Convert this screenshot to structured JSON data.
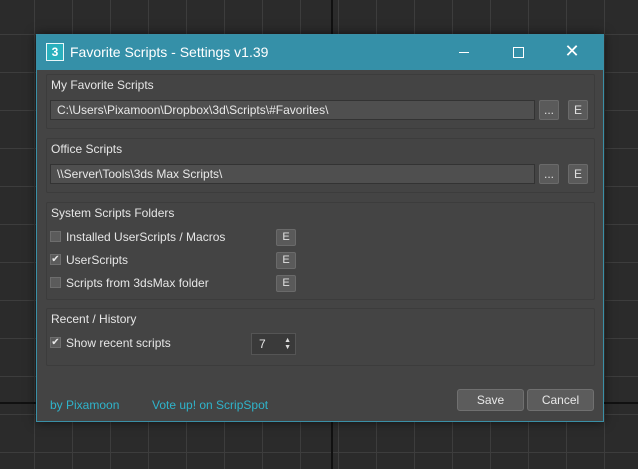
{
  "window": {
    "title": "Favorite Scripts - Settings v1.39",
    "app_icon_glyph": "3",
    "accent_color": "#3590a8",
    "close_glyph": "✕"
  },
  "favorite": {
    "title": "My Favorite Scripts",
    "path": "C:\\Users\\Pixamoon\\Dropbox\\3d\\Scripts\\#Favorites\\",
    "browse_label": "...",
    "edit_label": "E"
  },
  "office": {
    "title": "Office Scripts",
    "path": "\\\\Server\\Tools\\3ds Max Scripts\\",
    "browse_label": "...",
    "edit_label": "E"
  },
  "system": {
    "title": "System Scripts Folders",
    "items": [
      {
        "label": "Installed UserScripts / Macros",
        "checked": false,
        "edit_label": "E"
      },
      {
        "label": "UserScripts",
        "checked": true,
        "edit_label": "E"
      },
      {
        "label": "Scripts from 3dsMax folder",
        "checked": false,
        "edit_label": "E"
      }
    ]
  },
  "recent": {
    "title": "Recent / History",
    "show_label": "Show recent scripts",
    "show_checked": true,
    "count": "7",
    "arrows": "▲\n▼"
  },
  "footer": {
    "author_link": "by Pixamoon",
    "vote_link": "Vote up! on ScripSpot",
    "link_color": "#2fb4cb",
    "save_label": "Save",
    "cancel_label": "Cancel"
  },
  "checkmark": "✔"
}
